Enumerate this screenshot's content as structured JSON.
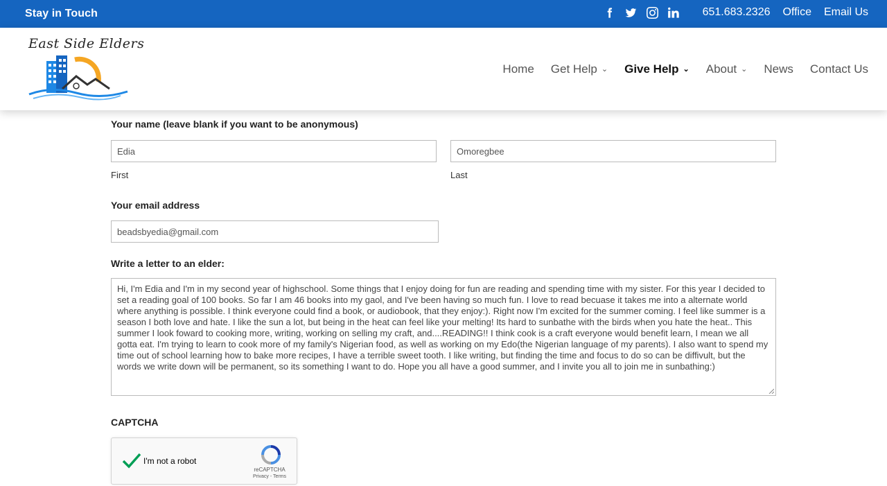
{
  "topbar": {
    "stay_in_touch": "Stay in Touch",
    "social_icons": [
      "facebook-icon",
      "twitter-icon",
      "instagram-icon",
      "linkedin-icon"
    ],
    "phone": "651.683.2326",
    "office": "Office",
    "email_us": "Email Us",
    "bg_color": "#1565c0"
  },
  "header": {
    "logo_text": "East Side Elders",
    "nav": [
      {
        "label": "Home",
        "dropdown": false
      },
      {
        "label": "Get Help",
        "dropdown": true
      },
      {
        "label": "Give Help",
        "dropdown": true,
        "active": true
      },
      {
        "label": "About",
        "dropdown": true
      },
      {
        "label": "News",
        "dropdown": false
      },
      {
        "label": "Contact Us",
        "dropdown": false
      }
    ]
  },
  "form": {
    "name_label": "Your name (leave blank if you want to be anonymous)",
    "first_value": "Edia",
    "first_sublabel": "First",
    "last_value": "Omoregbee",
    "last_sublabel": "Last",
    "email_label": "Your email address",
    "email_value": "beadsbyedia@gmail.com",
    "letter_label": "Write a letter to an elder:",
    "letter_value": "Hi, I'm Edia and I'm in my second year of highschool. Some things that I enjoy doing for fun are reading and spending time with my sister. For this year I decided to set a reading goal of 100 books. So far I am 46 books into my gaol, and I've been having so much fun. I love to read becuase it takes me into a alternate world where anything is possible. I think everyone could find a book, or audiobook, that they enjoy:). Right now I'm excited for the summer coming. I feel like summer is a season I both love and hate. I like the sun a lot, but being in the heat can feel like your melting! Its hard to sunbathe with the birds when you hate the heat.. This summer I look foward to cooking more, writing, working on selling my craft, and....READING!! I think cook is a craft everyone would benefit learn, I mean we all gotta eat. I'm trying to learn to cook more of my family's Nigerian food, as well as working on my Edo(the Nigerian language of my parents). I also want to spend my time out of school learning how to bake more recipes, I have a terrible sweet tooth. I like writing, but finding the time and focus to do so can be diffivult, but the words we write down will be permanent, so its something I want to do. Hope you all have a good summer, and I invite you all to join me in sunbathing:)",
    "captcha_label": "CAPTCHA"
  },
  "recaptcha": {
    "text": "I'm not a robot",
    "brand": "reCAPTCHA",
    "terms": "Privacy - Terms",
    "checked": true
  }
}
